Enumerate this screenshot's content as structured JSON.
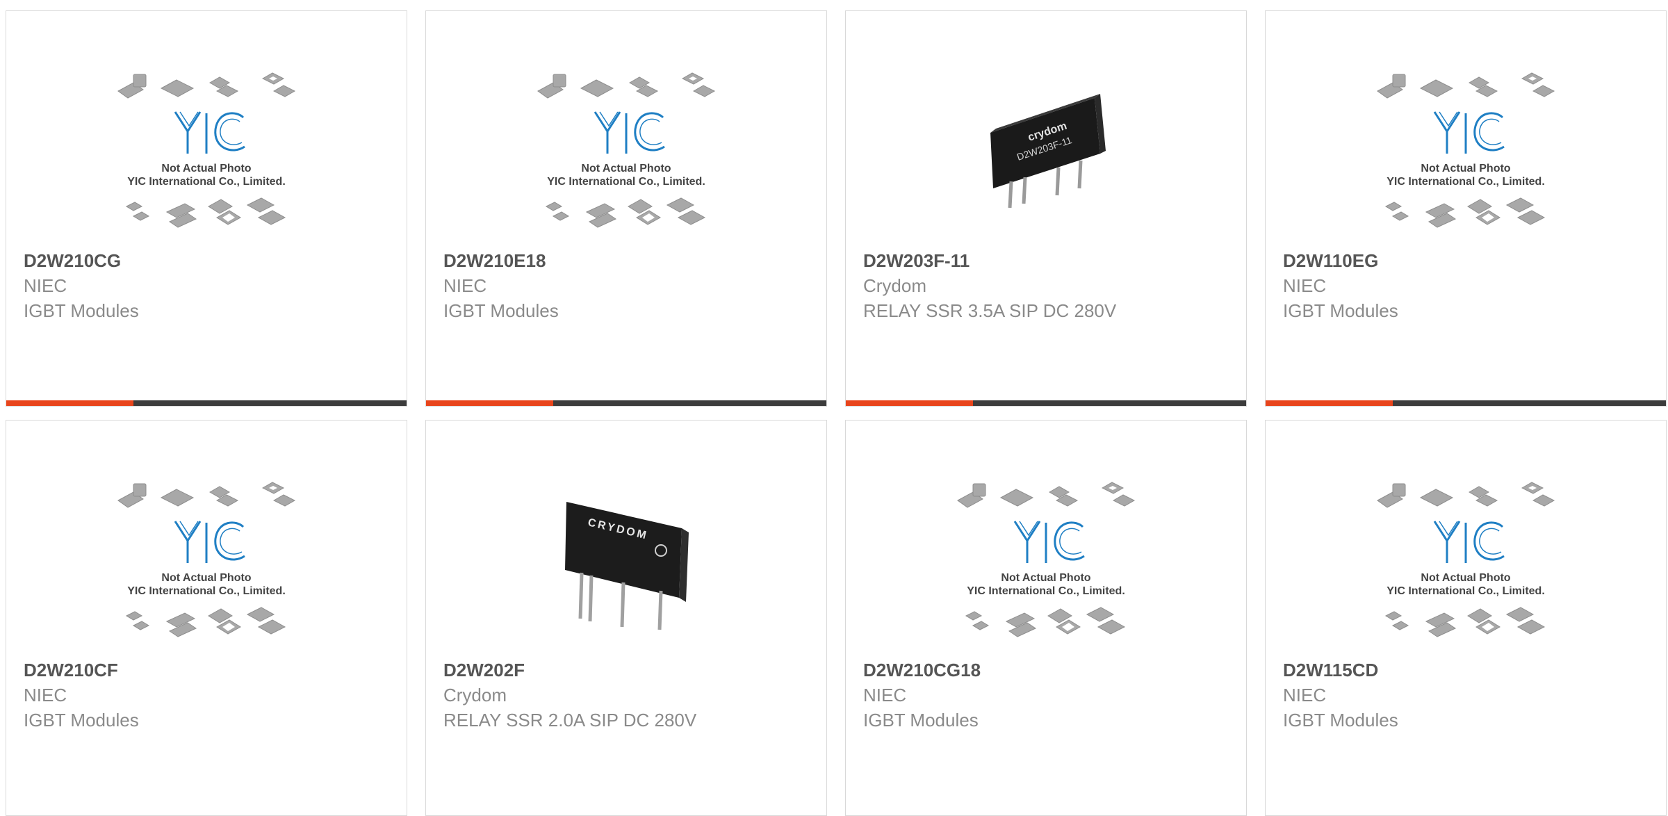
{
  "products": [
    {
      "part_number": "D2W210CG",
      "manufacturer": "NIEC",
      "description": "IGBT Modules",
      "image": "placeholder",
      "placeholder_text": [
        "Not Actual Photo",
        "YIC International Co., Limited."
      ],
      "show_bar": true
    },
    {
      "part_number": "D2W210E18",
      "manufacturer": "NIEC",
      "description": "IGBT Modules",
      "image": "placeholder",
      "placeholder_text": [
        "Not Actual Photo",
        "YIC International Co., Limited."
      ],
      "show_bar": true
    },
    {
      "part_number": "D2W203F-11",
      "manufacturer": "Crydom",
      "description": "RELAY SSR 3.5A SIP DC 280V",
      "image": "relay-photo",
      "relay_print": [
        "crydom",
        "D2W203F-11"
      ],
      "show_bar": true
    },
    {
      "part_number": "D2W110EG",
      "manufacturer": "NIEC",
      "description": "IGBT Modules",
      "image": "placeholder",
      "placeholder_text": [
        "Not Actual Photo",
        "YIC International Co., Limited."
      ],
      "show_bar": true
    },
    {
      "part_number": "D2W210CF",
      "manufacturer": "NIEC",
      "description": "IGBT Modules",
      "image": "placeholder",
      "placeholder_text": [
        "Not Actual Photo",
        "YIC International Co., Limited."
      ],
      "show_bar": false
    },
    {
      "part_number": "D2W202F",
      "manufacturer": "Crydom",
      "description": "RELAY SSR 2.0A SIP DC 280V",
      "image": "relay-photo",
      "relay_print": [
        "CRYDOM"
      ],
      "show_bar": false
    },
    {
      "part_number": "D2W210CG18",
      "manufacturer": "NIEC",
      "description": "IGBT Modules",
      "image": "placeholder",
      "placeholder_text": [
        "Not Actual Photo",
        "YIC International Co., Limited."
      ],
      "show_bar": false
    },
    {
      "part_number": "D2W115CD",
      "manufacturer": "NIEC",
      "description": "IGBT Modules",
      "image": "placeholder",
      "placeholder_text": [
        "Not Actual Photo",
        "YIC International Co., Limited."
      ],
      "show_bar": false
    }
  ],
  "colors": {
    "accent": "#e8451c",
    "bar": "#3c3c3c",
    "logo_blue": "#1f7fc4",
    "title_text": "#555555",
    "body_text": "#8a8a8a"
  }
}
